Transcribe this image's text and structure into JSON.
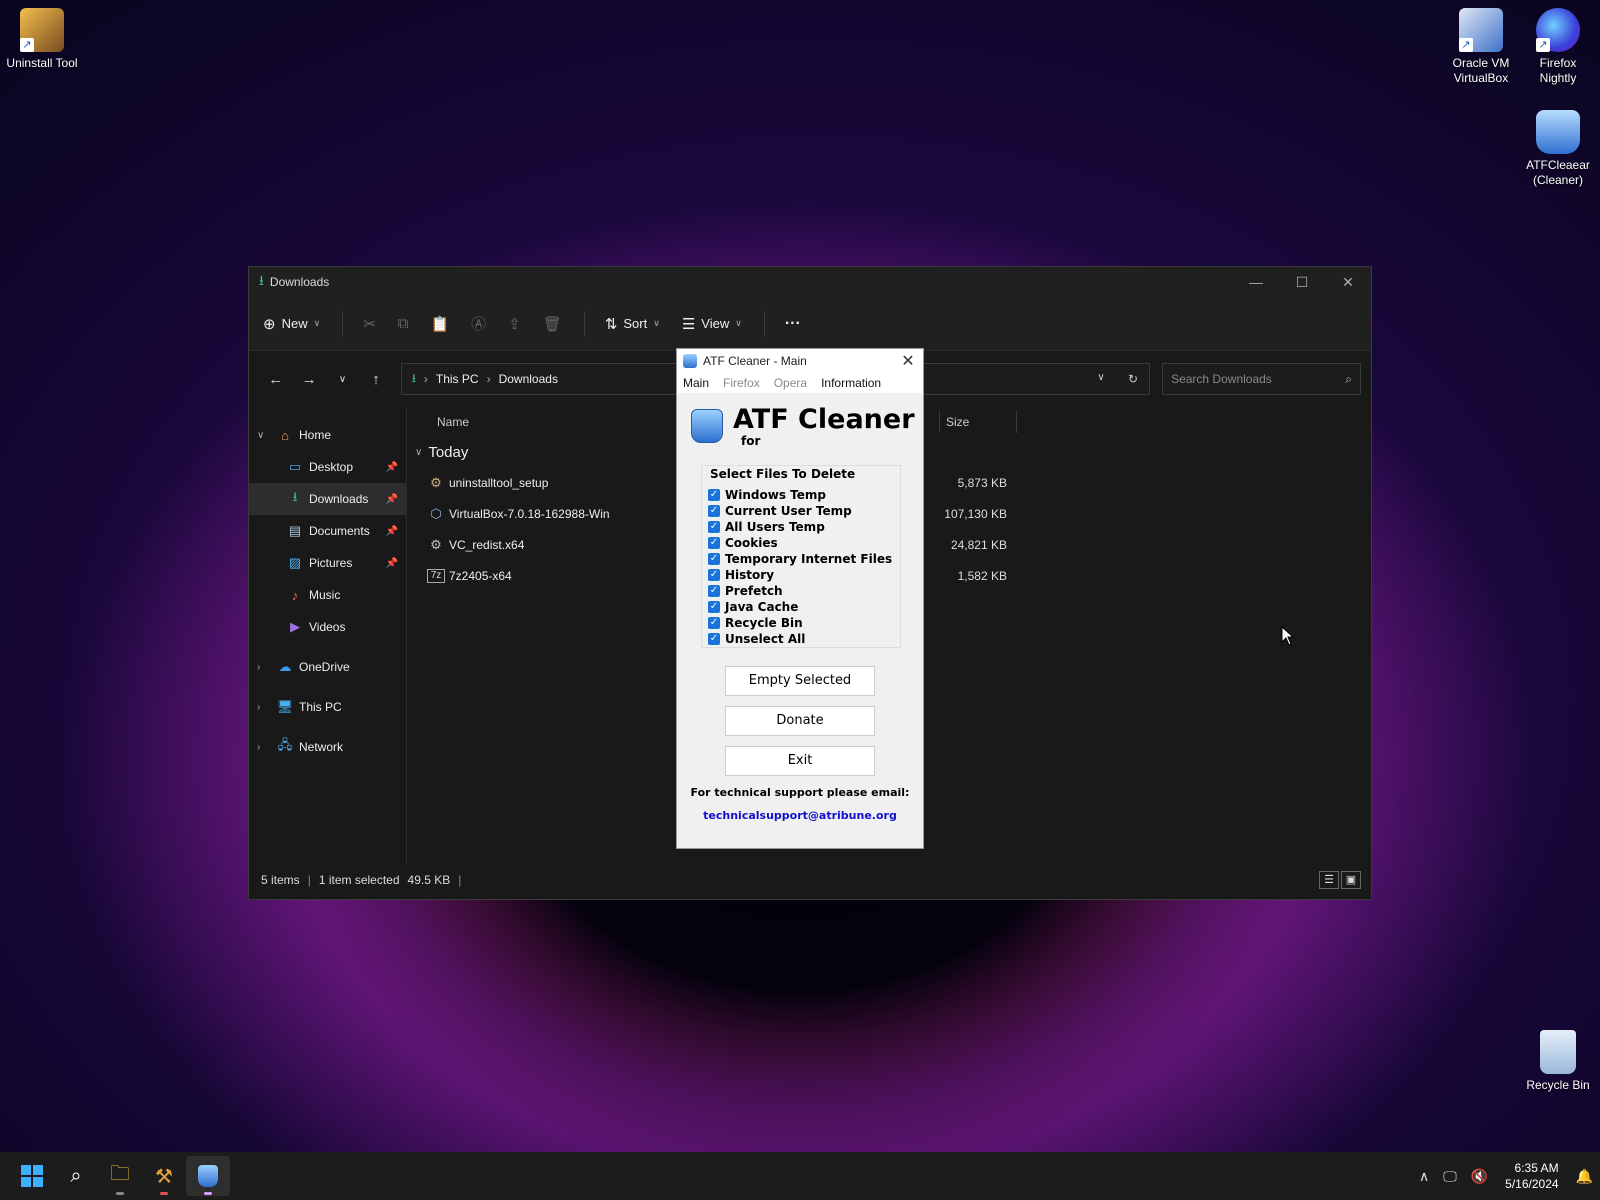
{
  "desktop": {
    "icons": [
      {
        "label": "Uninstall Tool"
      },
      {
        "label_line1": "Oracle VM",
        "label_line2": "VirtualBox"
      },
      {
        "label_line1": "Firefox",
        "label_line2": "Nightly"
      },
      {
        "label_line1": "ATFCleaear",
        "label_line2": "(Cleaner)"
      },
      {
        "label": "Recycle Bin"
      }
    ]
  },
  "explorer": {
    "title": "Downloads",
    "toolbar": {
      "new_label": "New",
      "sort_label": "Sort",
      "view_label": "View",
      "more_label": "···"
    },
    "address": {
      "root": "This PC",
      "current": "Downloads"
    },
    "search": {
      "placeholder": "Search Downloads"
    },
    "nav": {
      "home": "Home",
      "desktop": "Desktop",
      "downloads": "Downloads",
      "documents": "Documents",
      "pictures": "Pictures",
      "music": "Music",
      "videos": "Videos",
      "onedrive": "OneDrive",
      "thispc": "This PC",
      "network": "Network"
    },
    "columns": {
      "name": "Name",
      "size": "Size"
    },
    "group": "Today",
    "files": [
      {
        "name": "uninstalltool_setup",
        "size": "5,873 KB"
      },
      {
        "name": "VirtualBox-7.0.18-162988-Win",
        "size": "107,130 KB"
      },
      {
        "name": "VC_redist.x64",
        "size": "24,821 KB"
      },
      {
        "name": "7z2405-x64",
        "size": "1,582 KB"
      }
    ],
    "status": {
      "items": "5 items",
      "selected": "1 item selected",
      "size": "49.5 KB"
    }
  },
  "atf": {
    "title": "ATF Cleaner - Main",
    "menu": [
      "Main",
      "Firefox",
      "Opera",
      "Information"
    ],
    "app_name": "ATF Cleaner",
    "for_label": "for",
    "group_label": "Select Files To Delete",
    "checks": [
      "Windows Temp",
      "Current User Temp",
      "All Users Temp",
      "Cookies",
      "Temporary Internet Files",
      "History",
      "Prefetch",
      "Java Cache",
      "Recycle Bin",
      "Unselect All"
    ],
    "buttons": {
      "empty": "Empty Selected",
      "donate": "Donate",
      "exit": "Exit"
    },
    "support_text": "For technical support please email:",
    "email": "technicalsupport@atribune.org"
  },
  "taskbar": {
    "time": "6:35 AM",
    "date": "5/16/2024"
  },
  "colors": {
    "accent": "#1a73d9",
    "downloads_icon": "#38c0a0",
    "email_link": "#1010d0"
  }
}
